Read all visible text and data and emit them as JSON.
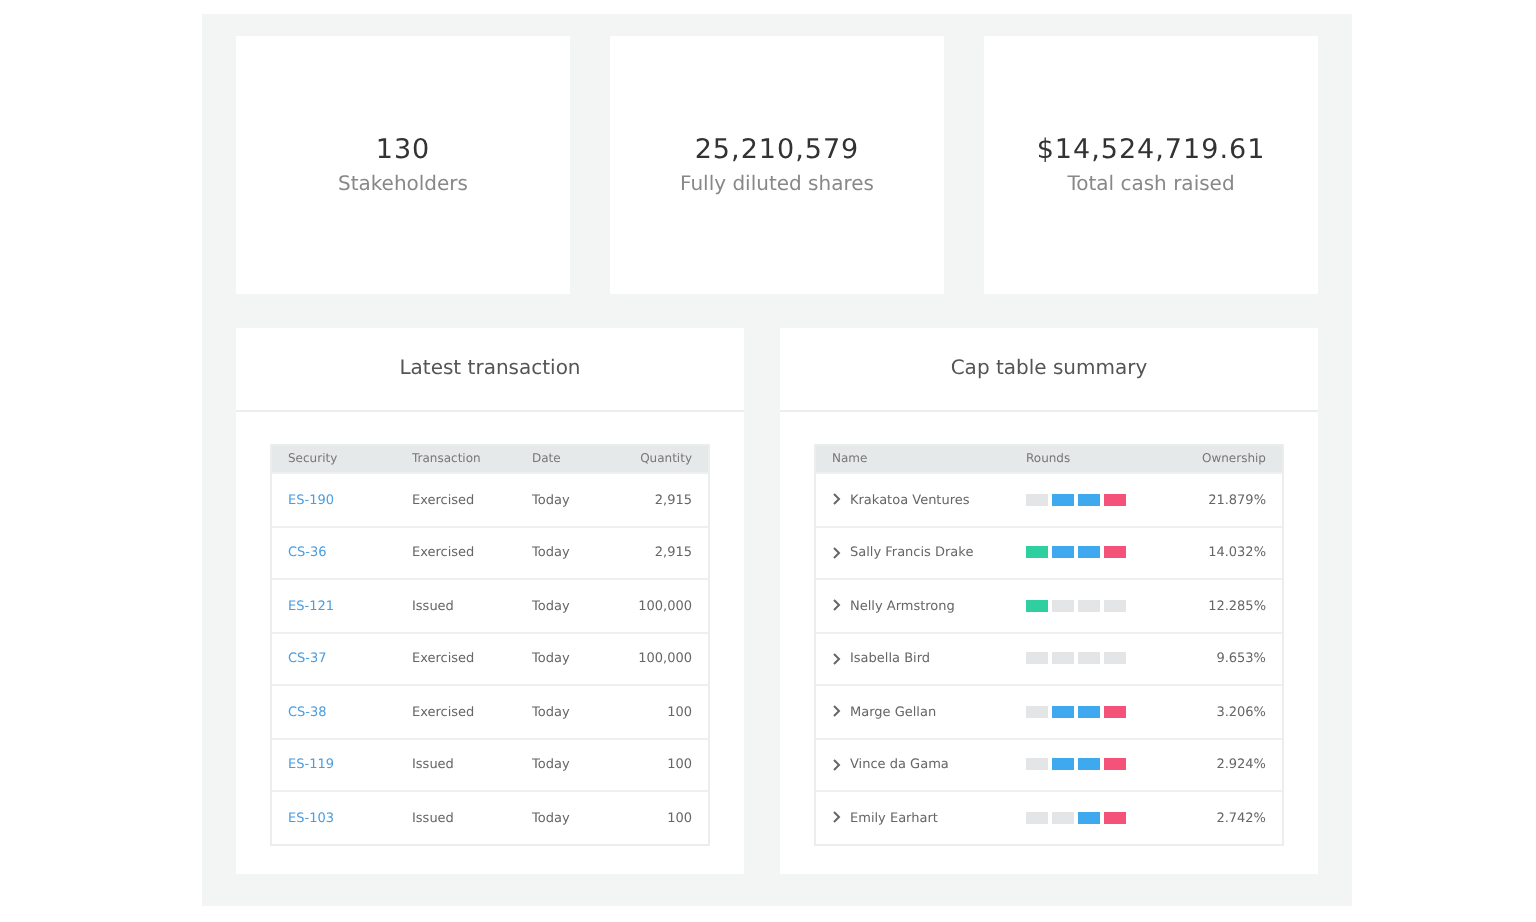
{
  "stats": [
    {
      "value": "130",
      "label": "Stakeholders"
    },
    {
      "value": "25,210,579",
      "label": "Fully diluted shares"
    },
    {
      "value": "$14,524,719.61",
      "label": "Total cash raised"
    }
  ],
  "latest_transaction": {
    "title": "Latest transaction",
    "columns": [
      "Security",
      "Transaction",
      "Date",
      "Quantity"
    ],
    "rows": [
      {
        "security": "ES-190",
        "transaction": "Exercised",
        "date": "Today",
        "quantity": "2,915"
      },
      {
        "security": "CS-36",
        "transaction": "Exercised",
        "date": "Today",
        "quantity": "2,915"
      },
      {
        "security": "ES-121",
        "transaction": "Issued",
        "date": "Today",
        "quantity": "100,000"
      },
      {
        "security": "CS-37",
        "transaction": "Exercised",
        "date": "Today",
        "quantity": "100,000"
      },
      {
        "security": "CS-38",
        "transaction": "Exercised",
        "date": "Today",
        "quantity": "100"
      },
      {
        "security": "ES-119",
        "transaction": "Issued",
        "date": "Today",
        "quantity": "100"
      },
      {
        "security": "ES-103",
        "transaction": "Issued",
        "date": "Today",
        "quantity": "100"
      }
    ]
  },
  "cap_table_summary": {
    "title": "Cap table summary",
    "columns": [
      "Name",
      "Rounds",
      "Ownership"
    ],
    "rows": [
      {
        "name": "Krakatoa Ventures",
        "rounds": [
          {
            "on": false
          },
          {
            "on": true
          },
          {
            "on": true
          },
          {
            "on": true
          }
        ],
        "ownership": "21.879%"
      },
      {
        "name": "Sally Francis Drake",
        "rounds": [
          {
            "on": true
          },
          {
            "on": true
          },
          {
            "on": true
          },
          {
            "on": true
          }
        ],
        "ownership": "14.032%"
      },
      {
        "name": "Nelly Armstrong",
        "rounds": [
          {
            "on": true
          },
          {
            "on": false
          },
          {
            "on": false
          },
          {
            "on": false
          }
        ],
        "ownership": "12.285%"
      },
      {
        "name": "Isabella Bird",
        "rounds": [
          {
            "on": false
          },
          {
            "on": false
          },
          {
            "on": false
          },
          {
            "on": false
          }
        ],
        "ownership": "9.653%"
      },
      {
        "name": "Marge Gellan",
        "rounds": [
          {
            "on": false
          },
          {
            "on": true
          },
          {
            "on": true
          },
          {
            "on": true
          }
        ],
        "ownership": "3.206%"
      },
      {
        "name": "Vince da Gama",
        "rounds": [
          {
            "on": false
          },
          {
            "on": true
          },
          {
            "on": true
          },
          {
            "on": true
          }
        ],
        "ownership": "2.924%"
      },
      {
        "name": "Emily Earhart",
        "rounds": [
          {
            "on": false
          },
          {
            "on": false
          },
          {
            "on": true
          },
          {
            "on": true
          }
        ],
        "ownership": "2.742%"
      }
    ]
  }
}
